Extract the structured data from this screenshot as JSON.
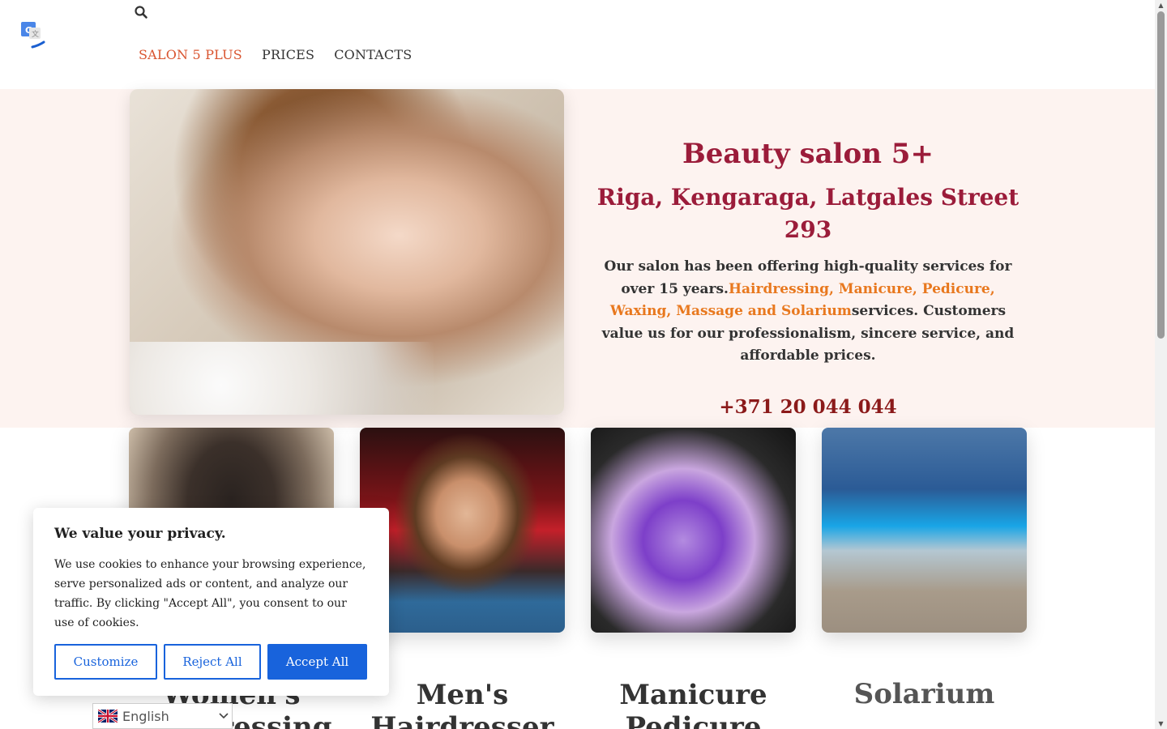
{
  "header": {
    "search_icon": "search-icon",
    "logo_icon": "translate-logo-icon",
    "nav": [
      {
        "label": "SALON 5 PLUS",
        "active": true
      },
      {
        "label": "PRICES",
        "active": false
      },
      {
        "label": "CONTACTS",
        "active": false
      }
    ]
  },
  "hero": {
    "title": "Beauty salon 5+",
    "address": "Riga, Ķengaraga, Latgales Street 293",
    "desc_start": "Our salon has been offering high-quality services for over 15 years.",
    "desc_highlight": "Hairdressing, Manicure, Pedicure, Waxing, Massage and Solarium",
    "desc_end": "services. Customers value us for our professionalism, sincere service, and affordable prices.",
    "phone": "+371 20 044 044"
  },
  "services": [
    {
      "title": "Women's Hairdressing"
    },
    {
      "title": "Men's Hairdresser"
    },
    {
      "title": "Manicure Pedicure"
    },
    {
      "title": "Solarium"
    }
  ],
  "cookie": {
    "title": "We value your privacy.",
    "text": "We use cookies to enhance your browsing experience, serve personalized ads or content, and analyze our traffic. By clicking \"Accept All\", you consent to our use of cookies.",
    "customize": "Customize",
    "reject": "Reject All",
    "accept": "Accept All"
  },
  "language": {
    "selected": "English"
  },
  "colors": {
    "brand_red": "#9b1c3a",
    "accent_orange": "#e8781e",
    "nav_active": "#d9542f",
    "cookie_blue": "#1863dc",
    "hero_bg": "#fdf3f0"
  }
}
